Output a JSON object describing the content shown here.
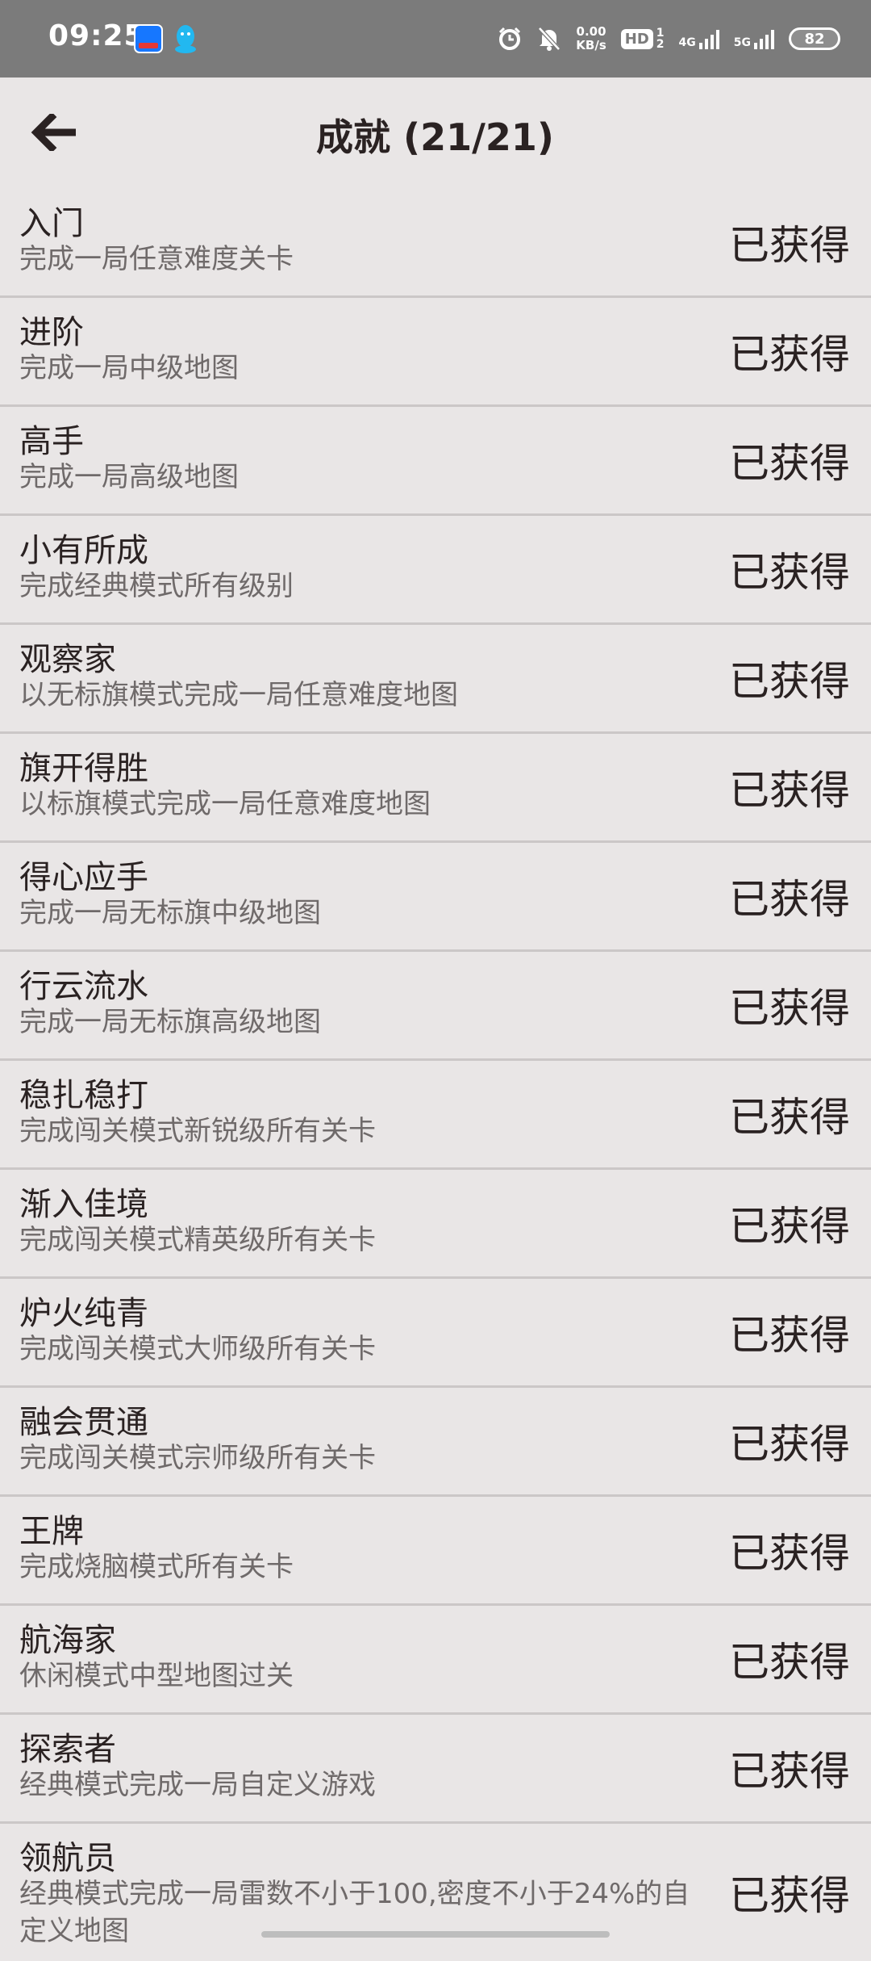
{
  "status_bar": {
    "time": "09:25",
    "net_speed_value": "0.00",
    "net_speed_unit": "KB/s",
    "hd_label": "HD",
    "sim1_label": "4G",
    "sim2_label": "5G",
    "battery": "82",
    "icons": [
      "alipay-app-icon",
      "qq-app-icon",
      "alarm-icon",
      "mute-icon",
      "hd-icon",
      "signal-4g-icon",
      "signal-5g-icon",
      "battery-icon"
    ]
  },
  "header": {
    "title": "成就 (21/21)",
    "back_icon": "arrow-left-icon"
  },
  "achievements": [
    {
      "title": "入门",
      "desc": "完成一局任意难度关卡",
      "status": "已获得"
    },
    {
      "title": "进阶",
      "desc": "完成一局中级地图",
      "status": "已获得"
    },
    {
      "title": "高手",
      "desc": "完成一局高级地图",
      "status": "已获得"
    },
    {
      "title": "小有所成",
      "desc": "完成经典模式所有级别",
      "status": "已获得"
    },
    {
      "title": "观察家",
      "desc": "以无标旗模式完成一局任意难度地图",
      "status": "已获得"
    },
    {
      "title": "旗开得胜",
      "desc": "以标旗模式完成一局任意难度地图",
      "status": "已获得"
    },
    {
      "title": "得心应手",
      "desc": "完成一局无标旗中级地图",
      "status": "已获得"
    },
    {
      "title": "行云流水",
      "desc": "完成一局无标旗高级地图",
      "status": "已获得"
    },
    {
      "title": "稳扎稳打",
      "desc": "完成闯关模式新锐级所有关卡",
      "status": "已获得"
    },
    {
      "title": "渐入佳境",
      "desc": "完成闯关模式精英级所有关卡",
      "status": "已获得"
    },
    {
      "title": "炉火纯青",
      "desc": "完成闯关模式大师级所有关卡",
      "status": "已获得"
    },
    {
      "title": "融会贯通",
      "desc": "完成闯关模式宗师级所有关卡",
      "status": "已获得"
    },
    {
      "title": "王牌",
      "desc": "完成烧脑模式所有关卡",
      "status": "已获得"
    },
    {
      "title": "航海家",
      "desc": "休闲模式中型地图过关",
      "status": "已获得"
    },
    {
      "title": "探索者",
      "desc": "经典模式完成一局自定义游戏",
      "status": "已获得"
    },
    {
      "title": "领航员",
      "desc": "经典模式完成一局雷数不小于100,密度不小于24%的自定义地图",
      "status": "已获得"
    }
  ]
}
